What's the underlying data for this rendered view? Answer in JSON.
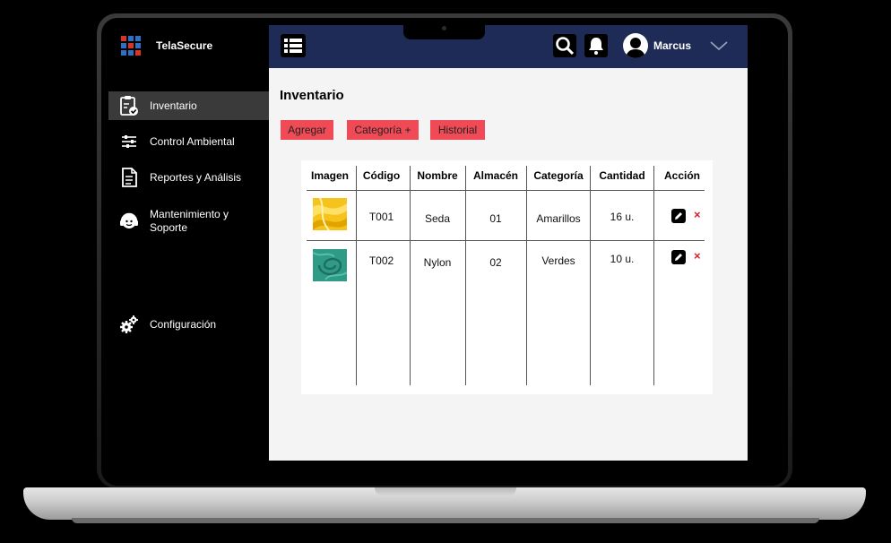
{
  "app": {
    "name": "TelaSecure"
  },
  "sidebar": {
    "items": [
      {
        "label": "Inventario",
        "icon": "clipboard-check-icon",
        "active": true
      },
      {
        "label": "Control Ambiental",
        "icon": "sliders-icon",
        "active": false
      },
      {
        "label": "Reportes y Análisis",
        "icon": "document-icon",
        "active": false
      },
      {
        "label_line1": "Mantenimiento y",
        "label_line2": "Soporte",
        "icon": "support-headset-icon",
        "active": false
      },
      {
        "label": "Configuración",
        "icon": "gears-icon",
        "active": false
      }
    ]
  },
  "topbar": {
    "menu_icon": "list-menu-icon",
    "search_icon": "search-icon",
    "bell_icon": "bell-icon",
    "user_name": "Marcus",
    "dropdown_icon": "chevron-down-icon",
    "background_color": "#1e2b56"
  },
  "main": {
    "title": "Inventario",
    "buttons": {
      "add": "Agregar",
      "category": "Categoría +",
      "history": "Historial"
    },
    "button_color": "#ef4a55"
  },
  "table": {
    "headers": [
      "Imagen",
      "Código",
      "Nombre",
      "Almacén",
      "Categoría",
      "Cantidad",
      "Acción"
    ],
    "rows": [
      {
        "image": "yellow-fabric",
        "code": "T001",
        "name": "Seda",
        "warehouse": "01",
        "category": "Amarillos",
        "quantity": "16 u."
      },
      {
        "image": "teal-fabric",
        "code": "T002",
        "name": "Nylon",
        "warehouse": "02",
        "category": "Verdes",
        "quantity": "10 u."
      }
    ],
    "edit_icon": "edit-pencil-icon",
    "delete_icon": "delete-x-icon",
    "delete_symbol": "×"
  },
  "colors": {
    "sidebar_active": "#3a3a3a",
    "delete": "#e01b24",
    "logo_red": "#d9342b",
    "logo_blue": "#2f6fc6"
  }
}
